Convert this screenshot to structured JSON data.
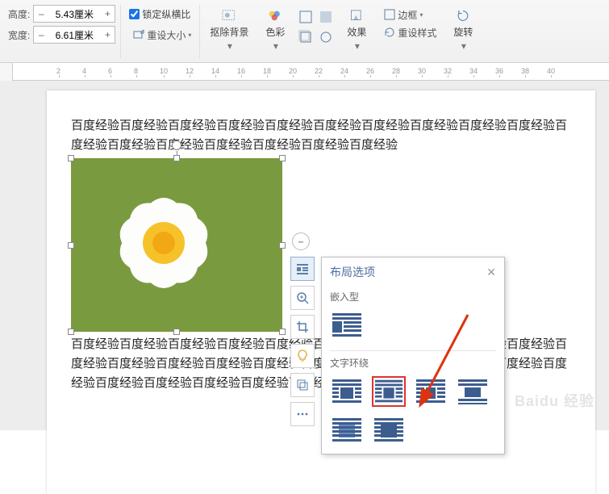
{
  "ribbon": {
    "height_label": "高度:",
    "width_label": "宽度:",
    "height_value": "5.43厘米",
    "width_value": "6.61厘米",
    "lock_ratio": "锁定纵横比",
    "reset_size": "重设大小",
    "remove_bg": "抠除背景",
    "color": "色彩",
    "effects": "效果",
    "border": "边框",
    "reset_style": "重设样式",
    "rotate": "旋转"
  },
  "ruler": {
    "ticks": [
      "2",
      "4",
      "6",
      "8",
      "10",
      "12",
      "14",
      "16",
      "18",
      "20",
      "22",
      "24",
      "26",
      "28",
      "30",
      "32",
      "34",
      "36",
      "38",
      "40"
    ]
  },
  "doc": {
    "text1": "百度经验百度经验百度经验百度经验百度经验百度经验百度经验百度经验百度经验百度经验百度经验百度经验百度经验百度经验百度经验百度经验百度经验",
    "text2": "百度经验百度经验百度经验百度经验百度经验百度经验百度经验百度经验百度经验百度经验百度经验百度经验百度经验百度经验百度经验百度经验百度经验百度经验百度经验百度经验百度经验百度经验百度经验百度经验百度经验百度经验百度经验"
  },
  "popover": {
    "title": "布局选项",
    "section_inline": "嵌入型",
    "section_wrap": "文字环绕"
  },
  "watermark": "Baidu 经验"
}
